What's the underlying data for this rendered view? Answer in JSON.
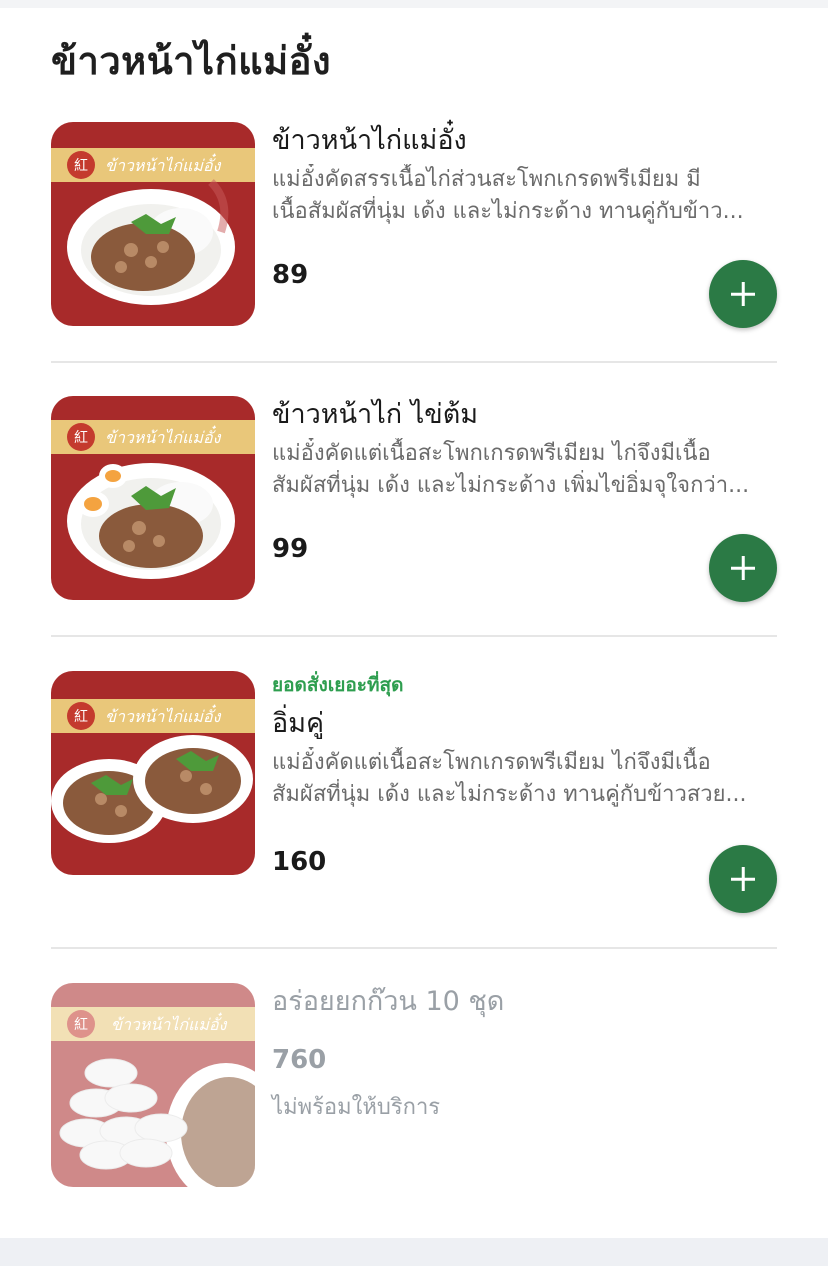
{
  "section": {
    "title": "ข้าวหน้าไก่แม่อั๋ง"
  },
  "items": [
    {
      "name": "ข้าวหน้าไก่แม่อั๋ง",
      "desc_line1": "แม่อั๋งคัดสรรเนื้อไก่ส่วนสะโพกเกรดพรีเมียม มี",
      "desc_line2": "เนื้อสัมผัสที่นุ่ม เด้ง และไม่กระด้าง ทานคู่กับข้าว...",
      "price": "89",
      "brand_text": "ข้าวหน้าไก่แม่อั๋ง"
    },
    {
      "name": "ข้าวหน้าไก่ ไข่ต้ม",
      "desc_line1": "แม่อั๋งคัดแต่เนื้อสะโพกเกรดพรีเมียม ไก่จึงมีเนื้อ",
      "desc_line2": "สัมผัสที่นุ่ม เด้ง และไม่กระด้าง เพิ่มไข่อิ่มจุใจกว่า...",
      "price": "99",
      "brand_text": "ข้าวหน้าไก่แม่อั๋ง"
    },
    {
      "badge": "ยอดสั่งเยอะที่สุด",
      "name": "อิ่มคู่",
      "desc_line1": "แม่อั๋งคัดแต่เนื้อสะโพกเกรดพรีเมียม ไก่จึงมีเนื้อ",
      "desc_line2": "สัมผัสที่นุ่ม เด้ง และไม่กระด้าง ทานคู่กับข้าวสวย...",
      "price": "160",
      "brand_text": "ข้าวหน้าไก่แม่อั๋ง"
    },
    {
      "name": "อร่อยยกก๊วน 10 ชุด",
      "price": "760",
      "status": "ไม่พร้อมให้บริการ",
      "brand_text": "ข้าวหน้าไก่แม่อั๋ง"
    }
  ],
  "colors": {
    "brand_red": "#a82a2a",
    "add_button": "#2b7a45",
    "badge_green": "#2e9e4f"
  },
  "icons": {
    "add": "plus-icon",
    "logo": "brand-logo"
  }
}
